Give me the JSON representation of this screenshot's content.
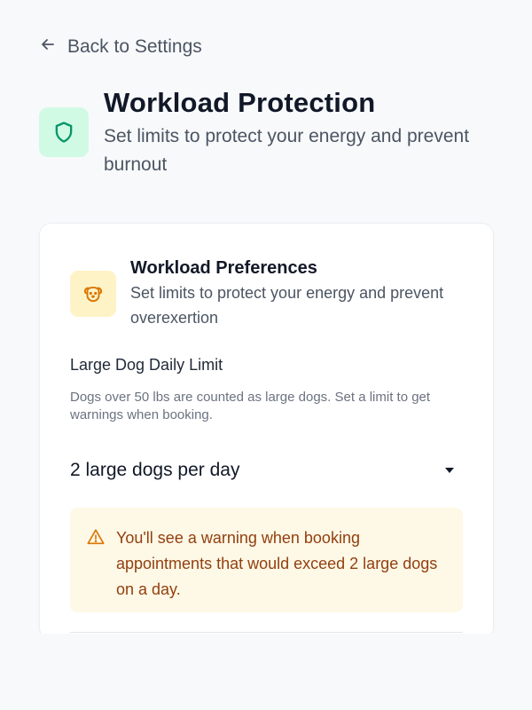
{
  "back": {
    "label": "Back to Settings",
    "icon": "arrow-left-icon"
  },
  "header": {
    "title": "Workload Protection",
    "subtitle": "Set limits to protect your energy and prevent burnout",
    "icon": "shield-icon",
    "icon_color": "#059669",
    "icon_bg": "#d1fae5"
  },
  "card": {
    "title": "Workload Preferences",
    "subtitle": "Set limits to protect your energy and prevent overexertion",
    "icon": "dog-icon",
    "icon_color": "#d97706",
    "icon_bg": "#fef3c7",
    "field": {
      "label": "Large Dog Daily Limit",
      "help": "Dogs over 50 lbs are counted as large dogs. Set a limit to get warnings when booking.",
      "selected": "2 large dogs per day"
    },
    "warning": {
      "icon": "alert-triangle-icon",
      "text": "You'll see a warning when booking appointments that would exceed 2 large dogs on a day.",
      "bg": "#fef8e7",
      "color": "#92400e"
    }
  }
}
